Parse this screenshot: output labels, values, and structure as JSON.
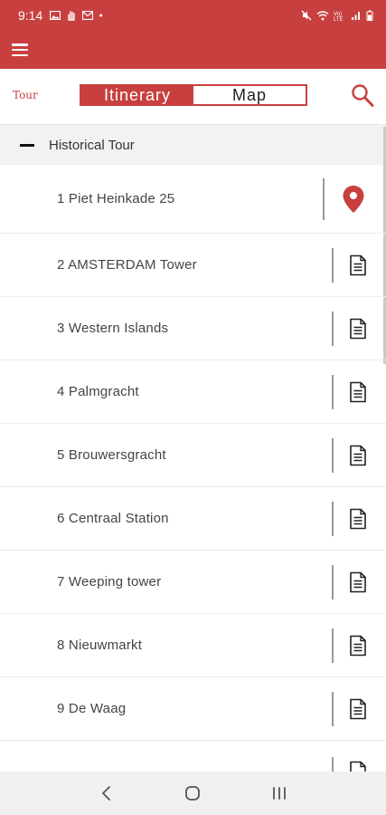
{
  "status_bar": {
    "time": "9:14",
    "left_icons": [
      "image-icon",
      "hand-icon",
      "envelope-icon",
      "dot-icon"
    ],
    "right_icons": [
      "mute-icon",
      "wifi-icon",
      "volte-icon",
      "signal-icon",
      "battery-icon"
    ]
  },
  "app_bar": {
    "menu_icon": "hamburger-icon",
    "color": "#c7403f"
  },
  "tabs": {
    "tour_label": "Tour",
    "itinerary": "Itinerary",
    "map": "Map",
    "search_icon": "search-icon"
  },
  "section": {
    "title": "Historical Tour",
    "collapse_icon": "minus-icon"
  },
  "items": [
    {
      "label": "1 Piet Heinkade 25",
      "icon": "map-pin-icon"
    },
    {
      "label": "2 AMSTERDAM Tower",
      "icon": "document-icon"
    },
    {
      "label": "3 Western Islands",
      "icon": "document-icon"
    },
    {
      "label": "4 Palmgracht",
      "icon": "document-icon"
    },
    {
      "label": "5 Brouwersgracht",
      "icon": "document-icon"
    },
    {
      "label": "6 Centraal Station",
      "icon": "document-icon"
    },
    {
      "label": "7 Weeping tower",
      "icon": "document-icon"
    },
    {
      "label": "8 Nieuwmarkt",
      "icon": "document-icon"
    },
    {
      "label": "9 De Waag",
      "icon": "document-icon"
    }
  ],
  "nav": {
    "back": "back-icon",
    "home": "home-icon",
    "recents": "recents-icon"
  },
  "colors": {
    "accent": "#c7403f",
    "section_bg": "#f2f2f2",
    "nav_bg": "#f0f0f0"
  }
}
